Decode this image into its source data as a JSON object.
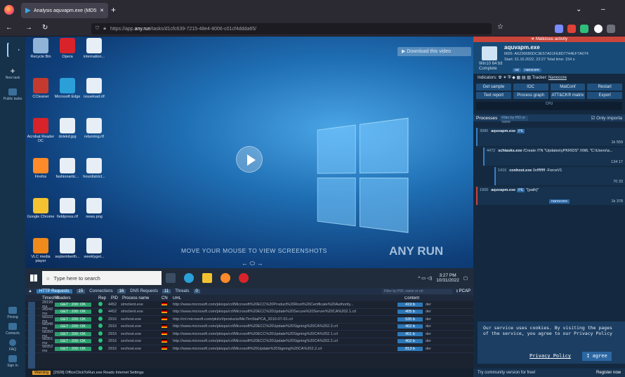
{
  "browser": {
    "tab_title": "Analysis aquvapm.exe (MD5: A",
    "new_tab": "+",
    "url_prefix": "https://app.",
    "url_host": "any.run",
    "url_path": "/tasks/d1cfc639-7215-48e4-8006-c01cf4ddda65/"
  },
  "leftnav": {
    "new_task": "New task",
    "public_tasks": "Public tasks",
    "pricing": "Pricing",
    "contacts": "Contacts",
    "faq": "FAQ",
    "signin": "Sign In"
  },
  "desktop": {
    "icons": [
      {
        "label": "Recycle Bin",
        "color": "#8fb4d8"
      },
      {
        "label": "Opera",
        "color": "#d8232a"
      },
      {
        "label": "internation...",
        "color": "#e7eef6"
      },
      {
        "label": "CCleaner",
        "color": "#c53a2f"
      },
      {
        "label": "Microsoft Edge",
        "color": "#2a9fd8"
      },
      {
        "label": "issueload.rtf",
        "color": "#e7eef6"
      },
      {
        "label": "Acrobat Reader DC",
        "color": "#d8232a"
      },
      {
        "label": "dolekd.jpg",
        "color": "#e7eef6"
      },
      {
        "label": "returning.rtf",
        "color": "#e7eef6"
      },
      {
        "label": "Firefox",
        "color": "#ff8a2a"
      },
      {
        "label": "fashionartic...",
        "color": "#e7eef6"
      },
      {
        "label": "hourdistrict...",
        "color": "#e7eef6"
      },
      {
        "label": "Google Chrome",
        "color": "#f2c230"
      },
      {
        "label": "fieldpress.rtf",
        "color": "#e7eef6"
      },
      {
        "label": "news.png",
        "color": "#e7eef6"
      },
      {
        "label": "VLC media player",
        "color": "#ef8a1b"
      },
      {
        "label": "septemberth...",
        "color": "#e7eef6"
      },
      {
        "label": "weeklyget...",
        "color": "#e7eef6"
      }
    ],
    "download_video": "Download this video",
    "move_mouse": "MOVE YOUR MOUSE TO VIEW SCREENSHOTS",
    "watermark": "ANY RUN"
  },
  "taskbar": {
    "search_placeholder": "Type here to search",
    "time": "3:27 PM",
    "date": "10/31/2022"
  },
  "network": {
    "tabs": {
      "http": "HTTP Requests",
      "http_count": "15",
      "connections": "Connections",
      "conn_count": "16",
      "dns": "DNS Requests",
      "dns_count": "11",
      "threats": "Threats",
      "threats_count": "0"
    },
    "filter_placeholder": "Filter by PID, name or url",
    "pcap": "PCAP",
    "headers": [
      "Timeshift",
      "Headers",
      "Rep",
      "PID",
      "Process name",
      "CN",
      "URL",
      "Content"
    ],
    "rows": [
      {
        "time": "28199 ms",
        "status": "GET : 200: OK",
        "pid": "4452",
        "proc": "slmclient.exe",
        "url": "http://www.microsoft.com/pkiops/crl/Microsoft%20ECC%20Product%20Root%20Certificate%20Authority...",
        "size": "419 b"
      },
      {
        "time": "28242 ms",
        "status": "GET : 200: OK",
        "pid": "4452",
        "proc": "slmclient.exe",
        "url": "http://www.microsoft.com/pkiops/crl/Microsoft%20ECC%20Update%20Secure%20Server%20CA%202.1.crl",
        "size": "405 b"
      },
      {
        "time": "58333 ms",
        "status": "GET : 200: OK",
        "pid": "2916",
        "proc": "svchost.exe",
        "url": "http://crl.microsoft.com/pki/crl/products/MicTimStaPCA_2010-07-01.crl",
        "size": "535 b"
      },
      {
        "time": "58348 ms",
        "status": "GET : 200: OK",
        "pid": "2916",
        "proc": "svchost.exe",
        "url": "http://www.microsoft.com/pkiops/crl/Microsoft%20ECC%20Update%20Signing%20CA%202.3.crl",
        "size": "402 b"
      },
      {
        "time": "58350 ms",
        "status": "GET : 200: OK",
        "pid": "2916",
        "proc": "svchost.exe",
        "url": "http://www.microsoft.com/pkiops/crl/Microsoft%20ECC%20Update%20Signing%20CA%202.1.crl",
        "size": "401 b"
      },
      {
        "time": "58351 ms",
        "status": "GET : 200: OK",
        "pid": "2916",
        "proc": "svchost.exe",
        "url": "http://www.microsoft.com/pkiops/crl/Microsoft%20ECC%20Update%20Signing%20CA%202.2.crl",
        "size": "402 b"
      },
      {
        "time": "58352 ms",
        "status": "GET : 200: OK",
        "pid": "2916",
        "proc": "svchost.exe",
        "url": "http://www.microsoft.com/pkiops/crl/Microsoft%20Update%20Signing%20CA%202.2.crl",
        "size": "813 b"
      }
    ],
    "der": "der"
  },
  "status": {
    "warning": "Warning",
    "message": "[2928] OfficeClickToRun.exe Reads Internet Settings"
  },
  "right": {
    "malicious": "Malicious activity",
    "exe": "aquvapm.exe",
    "md5": "MD5: A62366B0DC3E57A01FE8D7744EF7A074",
    "start": "Start: 31.10.2022, 22:27",
    "total": "Total time: 154 s",
    "os": "Win10 64 bit",
    "complete": "Complete",
    "tag1": "rat",
    "tag2": "nanocore",
    "indicators": "Indicators:",
    "tracker": "Tracker:",
    "tracker_name": "Nanocore",
    "buttons1": [
      "Get sample",
      "IOC",
      "MalConf",
      "Restart"
    ],
    "buttons2": [
      "Text report",
      "Process graph",
      "ATT&CK® matrix",
      "Export"
    ],
    "cpu": "CPU",
    "processes": "Processes",
    "proc_filter": "Filter by PID or name",
    "only_important": "Only importa",
    "procs": [
      {
        "pid": "3080",
        "name": "aquvapm.exe",
        "badge": "PE",
        "stats": "1k  559",
        "extra": ""
      },
      {
        "pid": "4472",
        "name": "schtasks.exe",
        "badge": "",
        "stats": "134  17",
        "extra": "/Create /TN \"Updates\\yPKRIDS\" /XML \"C:\\Users\\a..."
      },
      {
        "pid": "1416",
        "name": "conhost.exe",
        "badge": "",
        "stats": "70  33",
        "extra": "0xffffffff -ForceV1"
      },
      {
        "pid": "1900",
        "name": "aquvapm.exe",
        "badge": "PE",
        "stats": "1k  378",
        "extra": "\"{path}\""
      }
    ],
    "nanocore": "nanocore"
  },
  "cookie": {
    "text": "Our service uses cookies. By visiting the pages of the service, you agree to our Privacy Policy",
    "privacy_link": "Privacy Policy",
    "agree": "I agree"
  },
  "footer": {
    "community": "Try community version for free!",
    "register": "Register now"
  }
}
